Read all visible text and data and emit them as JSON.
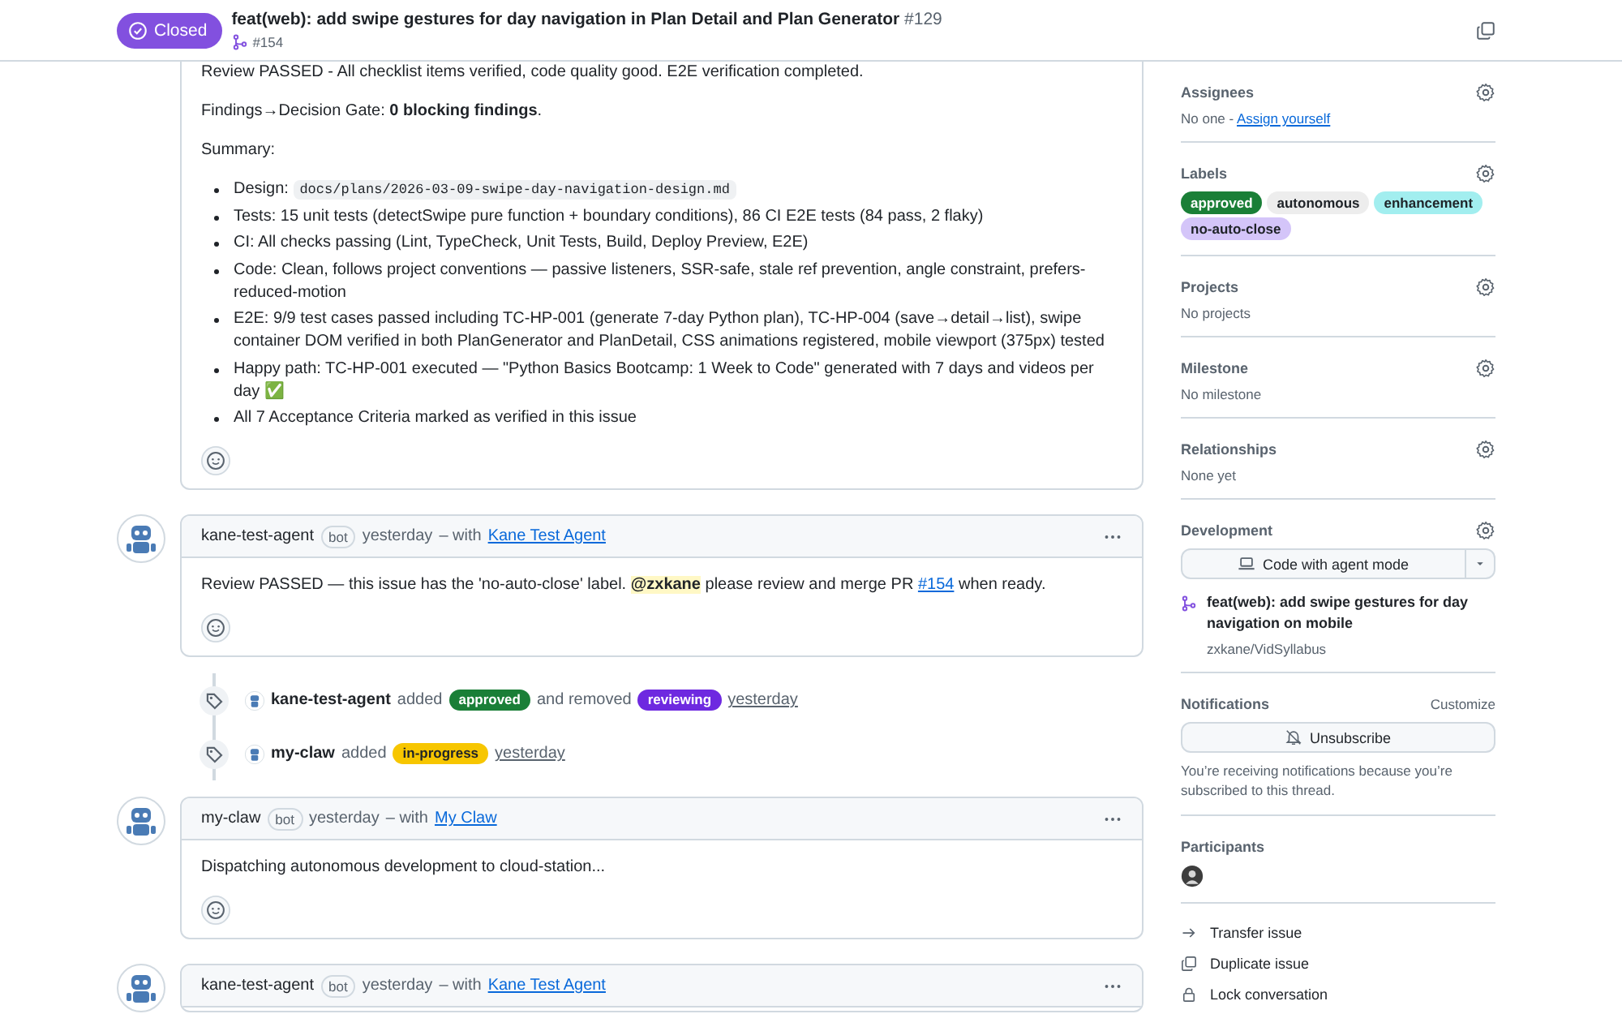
{
  "header": {
    "status": "Closed",
    "title": "feat(web): add swipe gestures for day navigation in Plan Detail and Plan Generator",
    "number": "#129",
    "pr": "#154"
  },
  "timeline": [
    {
      "kind": "comment",
      "blocks": [
        {
          "kind": "paragraph",
          "parts": [
            {
              "kind": "text",
              "text": "Review PASSED - All checklist items verified, code quality good. E2E verification completed."
            }
          ]
        },
        {
          "kind": "paragraph",
          "parts": [
            {
              "kind": "text",
              "text": "Findings→Decision Gate: "
            },
            {
              "kind": "bold",
              "text": "0 blocking findings"
            },
            {
              "kind": "text",
              "text": "."
            }
          ]
        },
        {
          "kind": "paragraph",
          "parts": [
            {
              "kind": "text",
              "text": "Summary:"
            }
          ]
        },
        {
          "kind": "list",
          "items": [
            [
              {
                "kind": "text",
                "text": "Design: "
              },
              {
                "kind": "code",
                "text": "docs/plans/2026-03-09-swipe-day-navigation-design.md"
              }
            ],
            [
              {
                "kind": "text",
                "text": "Tests: 15 unit tests (detectSwipe pure function + boundary conditions), 86 CI E2E tests (84 pass, 2 flaky)"
              }
            ],
            [
              {
                "kind": "text",
                "text": "CI: All checks passing (Lint, TypeCheck, Unit Tests, Build, Deploy Preview, E2E)"
              }
            ],
            [
              {
                "kind": "text",
                "text": "Code: Clean, follows project conventions — passive listeners, SSR-safe, stale ref prevention, angle constraint, prefers-reduced-motion"
              }
            ],
            [
              {
                "kind": "text",
                "text": "E2E: 9/9 test cases passed including TC-HP-001 (generate 7-day Python plan), TC-HP-004 (save→detail→list), swipe container DOM verified in both PlanGenerator and PlanDetail, CSS animations registered, mobile viewport (375px) tested"
              }
            ],
            [
              {
                "kind": "text",
                "text": "Happy path: TC-HP-001 executed — \"Python Basics Bootcamp: 1 Week to Code\" generated with 7 days and videos per day ✅"
              }
            ],
            [
              {
                "kind": "text",
                "text": "All 7 Acceptance Criteria marked as verified in this issue"
              }
            ]
          ]
        }
      ]
    },
    {
      "kind": "comment",
      "author": "kane-test-agent",
      "badge": "bot",
      "time": "yesterday",
      "via": "– with",
      "app": "Kane Test Agent",
      "blocks": [
        {
          "kind": "paragraph",
          "parts": [
            {
              "kind": "text",
              "text": "Review PASSED — this issue has the 'no-auto-close' label. "
            },
            {
              "kind": "mention",
              "text": "@zxkane"
            },
            {
              "kind": "text",
              "text": " please review and merge PR "
            },
            {
              "kind": "link",
              "text": "#154"
            },
            {
              "kind": "text",
              "text": " when ready."
            }
          ]
        }
      ]
    },
    {
      "kind": "event",
      "actor": "kane-test-agent",
      "actions": [
        {
          "verb": "added",
          "label": {
            "name": "approved",
            "color": "#1a7f37"
          }
        },
        {
          "verb": "and removed",
          "label": {
            "name": "reviewing",
            "color": "#6e29e0"
          }
        }
      ],
      "time": "yesterday"
    },
    {
      "kind": "event",
      "actor": "my-claw",
      "actions": [
        {
          "verb": "added",
          "label": {
            "name": "in-progress",
            "color": "#f7c600"
          }
        }
      ],
      "time": "yesterday"
    },
    {
      "kind": "comment",
      "author": "my-claw",
      "badge": "bot",
      "time": "yesterday",
      "via": "– with",
      "app": "My Claw",
      "blocks": [
        {
          "kind": "paragraph",
          "parts": [
            {
              "kind": "text",
              "text": "Dispatching autonomous development to cloud-station..."
            }
          ]
        }
      ]
    },
    {
      "kind": "comment",
      "author": "kane-test-agent",
      "badge": "bot",
      "time": "yesterday",
      "via": "– with",
      "app": "Kane Test Agent"
    }
  ],
  "sidebar": [
    {
      "kind": "text",
      "title": "Assignees",
      "settings": true,
      "text": "No one - ",
      "link": "Assign yourself"
    },
    {
      "kind": "labels",
      "title": "Labels",
      "settings": true,
      "labels": [
        {
          "name": "approved",
          "color": "#1a7f37"
        },
        {
          "name": "autonomous",
          "color": "#ededed"
        },
        {
          "name": "enhancement",
          "color": "#a2eeef"
        },
        {
          "name": "no-auto-close",
          "color": "#d4c5f9"
        }
      ]
    },
    {
      "kind": "text",
      "title": "Projects",
      "settings": true,
      "text": "No projects"
    },
    {
      "kind": "text",
      "title": "Milestone",
      "settings": true,
      "text": "No milestone"
    },
    {
      "kind": "text",
      "title": "Relationships",
      "settings": true,
      "text": "None yet"
    },
    {
      "kind": "development",
      "title": "Development",
      "settings": true,
      "button": "Code with agent mode",
      "pr_title": "feat(web): add swipe gestures for day navigation on mobile",
      "repo": "zxkane/VidSyllabus"
    },
    {
      "kind": "notifications",
      "title": "Notifications",
      "settings": false,
      "action": "Customize",
      "button": "Unsubscribe",
      "note": "You’re receiving notifications because you’re subscribed to this thread."
    },
    {
      "kind": "participants",
      "title": "Participants",
      "settings": false
    }
  ],
  "actions": [
    {
      "kind": "transfer",
      "label": "Transfer issue"
    },
    {
      "kind": "duplicate",
      "label": "Duplicate issue"
    },
    {
      "kind": "lock",
      "label": "Lock conversation"
    }
  ]
}
